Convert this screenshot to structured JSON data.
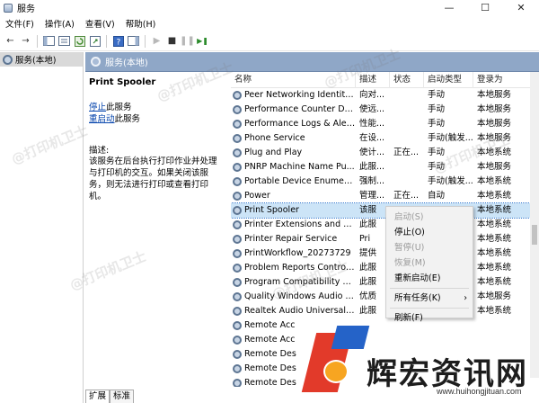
{
  "window": {
    "title": "服务",
    "min": "—",
    "max": "☐",
    "close": "✕"
  },
  "menu": [
    "文件(F)",
    "操作(A)",
    "查看(V)",
    "帮助(H)"
  ],
  "toolbar": {
    "back_icon": "←",
    "forward_icon": "→",
    "play_icon": "▶",
    "stop_icon": "■",
    "pause_icon": "❚❚",
    "restart_icon": "▶❚"
  },
  "tree": {
    "root_label": "服务(本地)"
  },
  "content_header": {
    "title": "服务(本地)"
  },
  "description": {
    "service_name": "Print Spooler",
    "stop_link": "停止",
    "stop_suffix": "此服务",
    "restart_link": "重启动",
    "restart_suffix": "此服务",
    "label": "描述:",
    "text": "该服务在后台执行打印作业并处理与打印机的交互。如果关闭该服务，则无法进行打印或查看打印机。"
  },
  "columns": [
    "名称",
    "描述",
    "状态",
    "启动类型",
    "登录为"
  ],
  "rows": [
    {
      "name": "Peer Networking Identity...",
      "desc": "向对...",
      "status": "",
      "startup": "手动",
      "logon": "本地服务"
    },
    {
      "name": "Performance Counter DL...",
      "desc": "使远...",
      "status": "",
      "startup": "手动",
      "logon": "本地服务"
    },
    {
      "name": "Performance Logs & Aler...",
      "desc": "性能...",
      "status": "",
      "startup": "手动",
      "logon": "本地服务"
    },
    {
      "name": "Phone Service",
      "desc": "在设...",
      "status": "",
      "startup": "手动(触发...",
      "logon": "本地服务"
    },
    {
      "name": "Plug and Play",
      "desc": "使计...",
      "status": "正在...",
      "startup": "手动",
      "logon": "本地系统"
    },
    {
      "name": "PNRP Machine Name Pu...",
      "desc": "此服...",
      "status": "",
      "startup": "手动",
      "logon": "本地服务"
    },
    {
      "name": "Portable Device Enumera...",
      "desc": "强制...",
      "status": "",
      "startup": "手动(触发...",
      "logon": "本地系统"
    },
    {
      "name": "Power",
      "desc": "管理...",
      "status": "正在...",
      "startup": "自动",
      "logon": "本地系统"
    },
    {
      "name": "Print Spooler",
      "desc": "该服",
      "status": "",
      "startup": "",
      "logon": "本地系统"
    },
    {
      "name": "Printer Extensions and N...",
      "desc": "此服",
      "status": "",
      "startup": "",
      "logon": "本地系统"
    },
    {
      "name": "Printer Repair Service",
      "desc": "Pri",
      "status": "",
      "startup": "",
      "logon": "本地系统"
    },
    {
      "name": "PrintWorkflow_20273729",
      "desc": "提供",
      "status": "",
      "startup": "",
      "logon": "本地系统"
    },
    {
      "name": "Problem Reports Control...",
      "desc": "此服",
      "status": "",
      "startup": "",
      "logon": "本地系统"
    },
    {
      "name": "Program Compatibility A...",
      "desc": "此服",
      "status": "",
      "startup": "",
      "logon": "本地系统"
    },
    {
      "name": "Quality Windows Audio V...",
      "desc": "优质",
      "status": "",
      "startup": "",
      "logon": "本地服务"
    },
    {
      "name": "Realtek Audio Universal ...",
      "desc": "此服",
      "status": "",
      "startup": "",
      "logon": "本地系统"
    },
    {
      "name": "Remote Acc",
      "desc": "",
      "status": "",
      "startup": "",
      "logon": ""
    },
    {
      "name": "Remote Acc",
      "desc": "",
      "status": "",
      "startup": "",
      "logon": ""
    },
    {
      "name": "Remote Des",
      "desc": "",
      "status": "",
      "startup": "",
      "logon": ""
    },
    {
      "name": "Remote Des",
      "desc": "",
      "status": "",
      "startup": "",
      "logon": ""
    },
    {
      "name": "Remote Des",
      "desc": "",
      "status": "",
      "startup": "",
      "logon": ""
    }
  ],
  "context_menu": {
    "start": "启动(S)",
    "stop": "停止(O)",
    "pause": "暂停(U)",
    "resume": "恢复(M)",
    "restart": "重新启动(E)",
    "all_tasks": "所有任务(K)",
    "all_tasks_arrow": "›",
    "refresh": "刷新(F)"
  },
  "tabs": [
    "扩展",
    "标准"
  ],
  "watermark": "@打印机卫士",
  "brand": {
    "name": "辉宏资讯网",
    "url": "www.huihongjituan.com"
  },
  "colors": {
    "header_blue": "#8fa7c7",
    "selection": "#cce4f7",
    "link": "#0645ad"
  }
}
